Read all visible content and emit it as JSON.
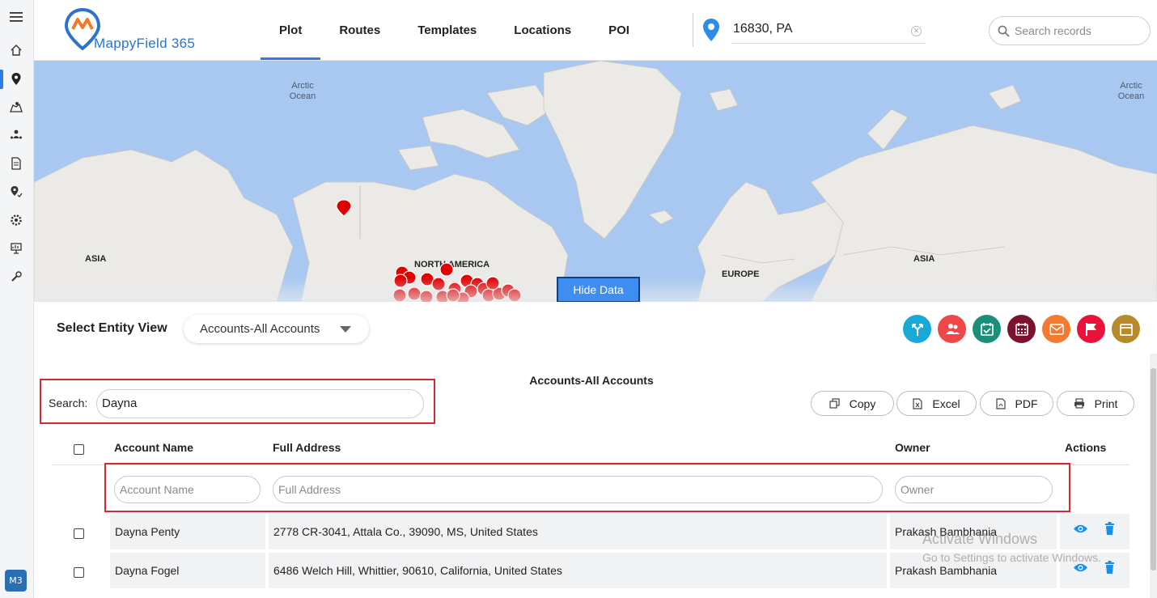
{
  "app": {
    "brand": "MappyField 365",
    "user_badge": "M3"
  },
  "nav": {
    "tabs": [
      {
        "label": "Plot"
      },
      {
        "label": "Routes"
      },
      {
        "label": "Templates"
      },
      {
        "label": "Locations"
      },
      {
        "label": "POI"
      }
    ],
    "active_tab": "Plot"
  },
  "location": {
    "value": "16830, PA"
  },
  "search_records": {
    "placeholder": "Search records"
  },
  "map": {
    "labels": {
      "arctic_left": "Arctic\nOcean",
      "arctic_right": "Arctic\nOcean",
      "asia_left": "ASIA",
      "north_america": "NORTH AMERICA",
      "europe": "EUROPE",
      "asia_right": "ASIA"
    },
    "hide_data_label": "Hide Data"
  },
  "entity": {
    "label": "Select Entity View",
    "selected": "Accounts-All Accounts"
  },
  "action_colors": [
    "#19a9d8",
    "#f04848",
    "#1a8f7a",
    "#7a1230",
    "#f47a30",
    "#e8123a",
    "#b88a2a"
  ],
  "table": {
    "title": "Accounts-All Accounts",
    "search_label": "Search:",
    "search_value": "Dayna",
    "export_buttons": [
      "Copy",
      "Excel",
      "PDF",
      "Print"
    ],
    "columns": [
      "Account Name",
      "Full Address",
      "Owner",
      "Actions"
    ],
    "filters": {
      "account_name": "Account Name",
      "full_address": "Full Address",
      "owner": "Owner"
    },
    "rows": [
      {
        "name": "Dayna Penty",
        "address": "2778 CR-3041, Attala Co., 39090, MS, United States",
        "owner": "Prakash Bambhania"
      },
      {
        "name": "Dayna Fogel",
        "address": "6486 Welch Hill, Whittier, 90610, California, United States",
        "owner": "Prakash Bambhania"
      }
    ]
  },
  "watermark": {
    "line1": "Activate Windows",
    "line2": "Go to Settings to activate Windows."
  }
}
